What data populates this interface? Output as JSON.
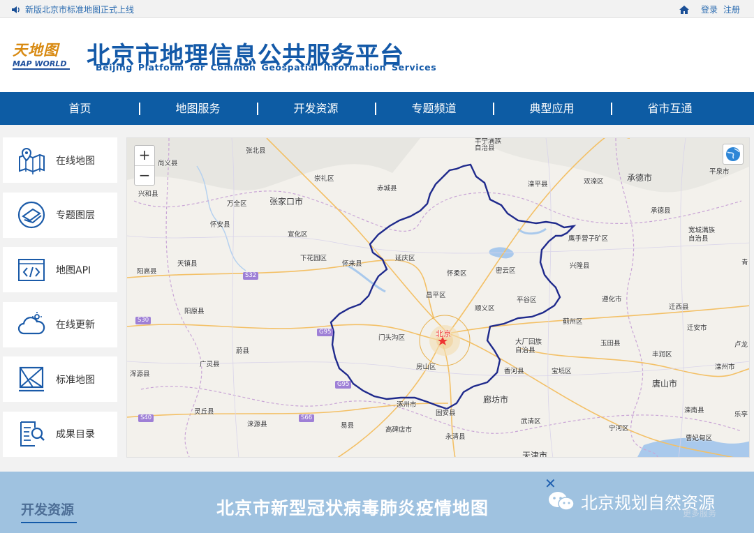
{
  "topbar": {
    "notice": "新版北京市标准地图正式上线",
    "login": "登录",
    "register": "注册"
  },
  "header": {
    "logo_cn": "天地图",
    "logo_en": "MAP WORLD",
    "title_cn": "北京市地理信息公共服务平台",
    "title_en": "Beijing Platform for Common Geospatial Information Services"
  },
  "nav": {
    "items": [
      "首页",
      "地图服务",
      "开发资源",
      "专题频道",
      "典型应用",
      "省市互通"
    ]
  },
  "sidebar": {
    "items": [
      {
        "label": "在线地图",
        "icon": "map-pin-icon"
      },
      {
        "label": "专题图层",
        "icon": "layers-icon"
      },
      {
        "label": "地图API",
        "icon": "code-icon"
      },
      {
        "label": "在线更新",
        "icon": "cloud-update-icon"
      },
      {
        "label": "标准地图",
        "icon": "standard-map-icon"
      },
      {
        "label": "成果目录",
        "icon": "catalog-search-icon"
      }
    ]
  },
  "map": {
    "zoom_in": "+",
    "zoom_out": "−",
    "labels": {
      "zhangbei": "张北县",
      "shangyi": "尚义县",
      "chongli": "崇礼区",
      "chicheng": "赤城县",
      "xinghe": "兴和县",
      "wanquan": "万全区",
      "zhangjiakou": "张家口市",
      "huaian": "怀安县",
      "xuanhua": "宣化区",
      "xiahuayuan": "下花园区",
      "huailai": "怀来县",
      "yanqing": "延庆区",
      "yanggao": "阳高县",
      "tianzhen": "天镇县",
      "yangyuan": "阳原县",
      "yuxian": "蔚县",
      "guangling": "广灵县",
      "hunyuan": "浑源县",
      "lingqiu": "灵丘县",
      "laiyuan": "涞源县",
      "yixian": "易县",
      "zhuozhou": "涿州市",
      "gaobeidian": "高碑店市",
      "yongqing": "永清县",
      "gu_an": "固安县",
      "langfang": "廊坊市",
      "wuqing": "武清区",
      "tianjin": "天津市",
      "beijing": "北京",
      "mentougou": "门头沟区",
      "fangshan": "房山区",
      "changping": "昌平区",
      "huairou": "怀柔区",
      "miyun": "密云区",
      "shunyi": "顺义区",
      "pinggu": "平谷区",
      "dachang": "大厂回族",
      "dachang2": "自治县",
      "xianghe": "香河县",
      "baodi": "宝坻区",
      "jizhou": "蓟州区",
      "yutian": "玉田县",
      "zunhua": "遵化市",
      "qianxi": "迁西县",
      "qian_an": "迁安市",
      "fengrun": "丰润区",
      "luanzhou": "滦州市",
      "tangshan": "唐山市",
      "luannan": "滦南县",
      "caofeidian": "曹妃甸区",
      "ninghe": "宁河区",
      "xinglong": "兴隆县",
      "yingshouyingzi": "鹰手营子矿区",
      "chengde": "承德市",
      "chengdexian": "承德县",
      "kuancheng": "宽城满族",
      "kuancheng2": "自治县",
      "pingquan": "平泉市",
      "luanping": "滦平县",
      "shuangqiao": "双滦区",
      "fengning": "丰宁满族",
      "fengning2": "自治县",
      "lulong": "卢龙",
      "leting": "乐亭",
      "qing": "青"
    },
    "roads": [
      "S32",
      "S30",
      "G95",
      "S40",
      "S66",
      "G95"
    ]
  },
  "bottom": {
    "dev_title": "开发资源",
    "banner": "北京市新型冠状病毒肺炎疫情地图",
    "wechat_name": "北京规划自然资源",
    "more": "更多服务",
    "close": "✕"
  },
  "colors": {
    "brand_blue": "#1359a8",
    "nav_blue": "#0d5ca4",
    "boundary": "#1f2a8c",
    "banner_bg": "#9fc2e0"
  }
}
